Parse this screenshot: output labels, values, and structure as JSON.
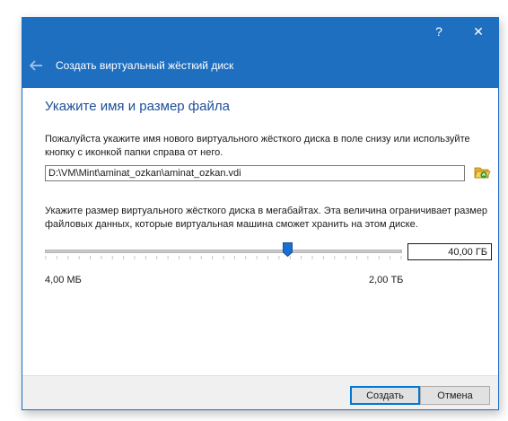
{
  "window": {
    "help_symbol": "?",
    "close_symbol": "✕",
    "wizard_title": "Создать виртуальный жёсткий диск"
  },
  "page": {
    "heading": "Укажите имя и размер файла",
    "location_description": "Пожалуйста укажите имя нового виртуального жёсткого диска в поле снизу или используйте кнопку с иконкой папки справа от него.",
    "file_path": "D:\\VM\\Mint\\aminat_ozkan\\aminat_ozkan.vdi",
    "size_description": "Укажите размер виртуального жёсткого диска в мегабайтах. Эта величина ограничивает размер файловых данных, которые виртуальная машина сможет хранить на этом диске.",
    "size_value": "40,00 ГБ",
    "slider_position": 0.68,
    "range_min": "4,00 МБ",
    "range_max": "2,00 ТБ"
  },
  "buttons": {
    "create": "Создать",
    "cancel": "Отмена"
  },
  "icons": {
    "back": "back-arrow-icon",
    "folder": "folder-open-icon",
    "help": "help-icon",
    "close": "close-icon"
  },
  "colors": {
    "titlebar": "#1e6fc0",
    "heading": "#1e4e9a",
    "slider_thumb": "#1a6fd0",
    "folder_icon": "#e8b030",
    "folder_arrow": "#2e9e2e"
  }
}
